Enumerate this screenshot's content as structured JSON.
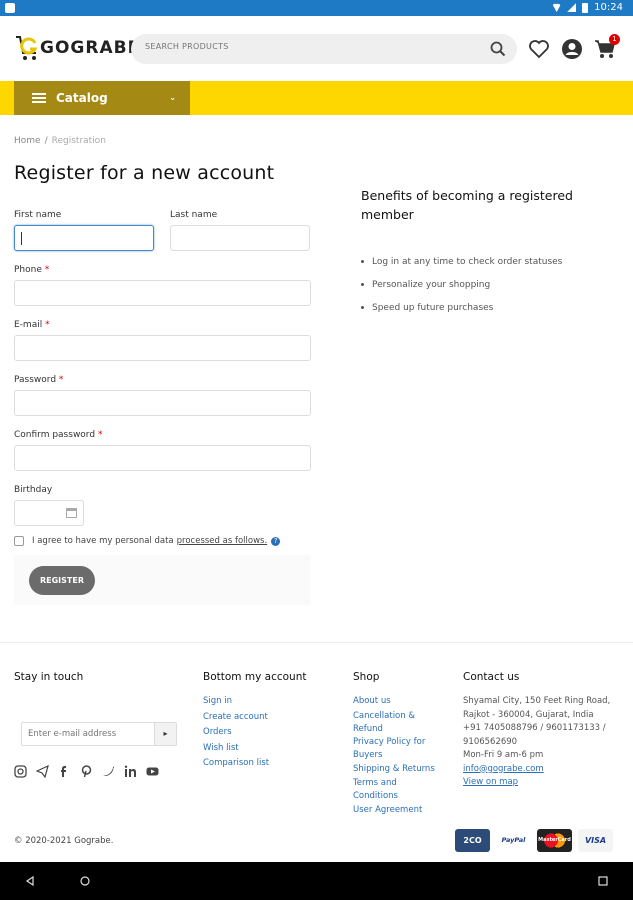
{
  "status_bar": {
    "time": "10:24"
  },
  "header": {
    "logo_text": "GOGRABE",
    "search_placeholder": "SEARCH PRODUCTS",
    "cart_count": "1"
  },
  "catalog": {
    "label": "Catalog"
  },
  "breadcrumb": {
    "home": "Home",
    "separator": "/",
    "current": "Registration"
  },
  "page_title": "Register for a new account",
  "form": {
    "first_name_label": "First name",
    "last_name_label": "Last name",
    "phone_label": "Phone",
    "email_label": "E-mail",
    "password_label": "Password",
    "confirm_password_label": "Confirm password",
    "birthday_label": "Birthday",
    "required_mark": "*",
    "agree_text": "I agree to have my personal data",
    "agree_link": "processed as follows.",
    "register_button": "REGISTER"
  },
  "benefits": {
    "title": "Benefits of becoming a registered member",
    "items": [
      "Log in at any time to check order statuses",
      "Personalize your shopping",
      "Speed up future purchases"
    ]
  },
  "footer": {
    "stay_in_touch": "Stay in touch",
    "email_placeholder": "Enter e-mail address",
    "go_arrow": "▸",
    "account_heading": "Bottom my account",
    "account_links": [
      "Sign in",
      "Create account",
      "Orders",
      "Wish list",
      "Comparison list"
    ],
    "shop_heading": "Shop",
    "shop_links": [
      "About us",
      "Cancellation & Refund",
      "Privacy Policy for Buyers",
      "Shipping & Returns",
      "Terms and Conditions",
      "User Agreement"
    ],
    "contact_heading": "Contact us",
    "address": "Shyamal City, 150 Feet Ring Road, Rajkot - 360004, Gujarat, India",
    "phones": "+91 7405088796 / 9601173133 / 9106562690",
    "hours": "Mon-Fri 9 am-6 pm",
    "email": "info@gograbe.com",
    "map_link": "View on map",
    "copyright": "© 2020-2021 Gograbe.",
    "payment_methods": [
      "2CO",
      "PayPal",
      "MasterCard",
      "VISA"
    ]
  }
}
